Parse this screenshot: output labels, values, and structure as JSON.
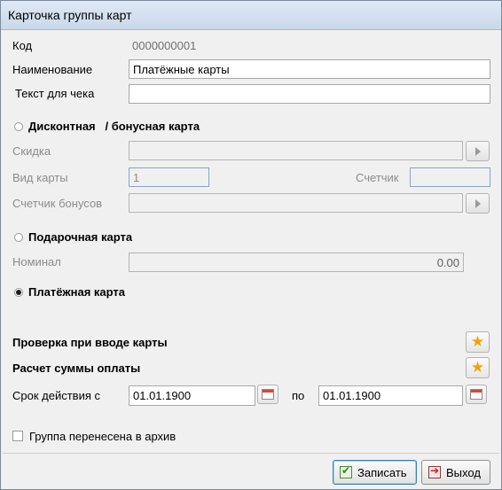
{
  "window": {
    "title": "Карточка группы карт"
  },
  "form": {
    "code_label": "Код",
    "code_value": "0000000001",
    "name_label": "Наименование",
    "name_value": "Платёжные карты",
    "receipt_text_label": "Текст для чека",
    "receipt_text_value": ""
  },
  "discount_section": {
    "title": "Дисконтная   / бонусная карта",
    "selected": false,
    "discount_label": "Скидка",
    "discount_value": "",
    "card_type_label": "Вид карты",
    "card_type_value": "1",
    "counter_label": "Счетчик",
    "counter_value": "",
    "bonus_counter_label": "Счетчик бонусов",
    "bonus_counter_value": ""
  },
  "gift_section": {
    "title": "Подарочная карта",
    "selected": false,
    "nominal_label": "Номинал",
    "nominal_value": "0.00"
  },
  "payment_section": {
    "title": "Платёжная карта",
    "selected": true,
    "check_on_input_label": "Проверка при вводе карты",
    "payment_calc_label": "Расчет суммы оплаты",
    "valid_from_label": "Срок действия с",
    "valid_from_value": "01.01.1900",
    "valid_to_label": "по",
    "valid_to_value": "01.01.1900"
  },
  "archive": {
    "label": "Группа перенесена в архив",
    "checked": false
  },
  "footer": {
    "save_label": "Записать",
    "exit_label": "Выход"
  },
  "icons": {
    "star": "star-icon",
    "calendar": "calendar-icon",
    "select": "play-arrow-icon",
    "save": "save-check-icon",
    "exit": "exit-door-icon"
  },
  "colors": {
    "star": "#f0a400",
    "default_button_border": "#3c7fb1",
    "disabled_text": "#8c8c8c"
  }
}
